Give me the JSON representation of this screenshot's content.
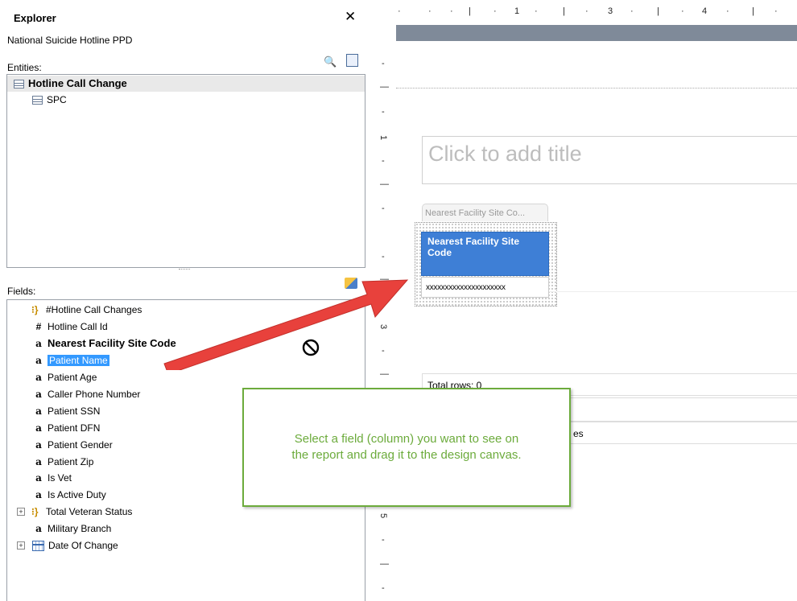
{
  "explorer": {
    "title": "Explorer",
    "subtitle": "National Suicide Hotline PPD",
    "entities_label": "Entities:",
    "fields_label": "Fields:",
    "entities": [
      {
        "label": "Hotline Call Change"
      },
      {
        "label": "SPC"
      }
    ],
    "fields": [
      {
        "label": "#Hotline Call Changes"
      },
      {
        "label": "Hotline Call Id"
      },
      {
        "label": "Nearest Facility Site Code"
      },
      {
        "label": "Patient Name"
      },
      {
        "label": "Patient Age"
      },
      {
        "label": "Caller Phone Number"
      },
      {
        "label": "Patient SSN"
      },
      {
        "label": "Patient DFN"
      },
      {
        "label": "Patient Gender"
      },
      {
        "label": "Patient Zip"
      },
      {
        "label": "Is Vet"
      },
      {
        "label": "Is Active Duty"
      },
      {
        "label": "Total Veteran Status"
      },
      {
        "label": "Military Branch"
      },
      {
        "label": "Date Of Change"
      }
    ]
  },
  "canvas": {
    "ruler_numbers": [
      "1",
      "3",
      "4"
    ],
    "left_ruler_numbers": [
      "1",
      "3",
      "5"
    ],
    "title_placeholder": "Click to add title",
    "column_tab": "Nearest Facility Site Co...",
    "column_header": "Nearest Facility Site Code",
    "column_value": "xxxxxxxxxxxxxxxxxxxxx",
    "total_rows": "Total rows: 0",
    "row3_text": "es"
  },
  "callout": {
    "line1": "Select a field (column) you want to see on",
    "line2": "the report and drag it to the design canvas."
  },
  "colors": {
    "selection": "#3399ff",
    "column_header": "#3e7fd6",
    "callout": "#6cab3c",
    "arrow": "#e8413c"
  }
}
